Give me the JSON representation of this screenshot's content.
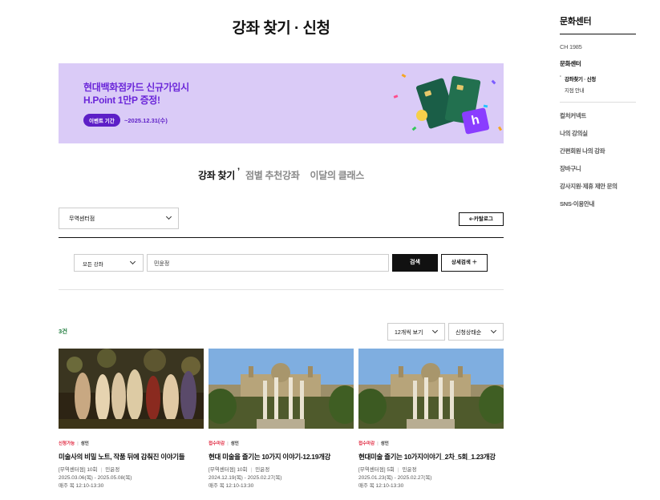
{
  "page": {
    "title": "강좌 찾기 · 신청"
  },
  "sidebar": {
    "title": "문화센터",
    "items": [
      {
        "label": "CH 1985"
      },
      {
        "label": "문화센터"
      }
    ],
    "subs": [
      {
        "label": "강좌찾기 · 신청"
      },
      {
        "label": "지점 안내"
      }
    ],
    "more": [
      {
        "label": "컬처커넥트"
      },
      {
        "label": "나의 강의실"
      },
      {
        "label": "간편회원 나의 강좌"
      },
      {
        "label": "장바구니"
      },
      {
        "label": "강사지원·제휴 제안 문의"
      },
      {
        "label": "SNS·이용안내"
      }
    ]
  },
  "banner": {
    "line1": "현대백화점카드 신규가입시",
    "line2": "H.Point 1만P 증정!",
    "badge": "이벤트 기간",
    "date": "~2025.12.31(수)",
    "colors": {
      "bg": "#dacbf7",
      "accent": "#6b27d9"
    }
  },
  "tabs": [
    {
      "label": "강좌 찾기"
    },
    {
      "label": "점별 추천강좌"
    },
    {
      "label": "이달의 클래스"
    }
  ],
  "filters": {
    "branch": "무역센터점",
    "catalog_label": "e-카탈로그",
    "category": "모든 강좌",
    "search_value": "민윤정",
    "search_label": "검색",
    "detail_label": "상세검색 ＋"
  },
  "results": {
    "count": "3건",
    "per_page": "12개씩 보기",
    "sort": "신청상태순"
  },
  "courses": [
    {
      "status": "신청가능",
      "type": "성인",
      "title": "미술사의 비밀 노트, 작품 뒤에 감춰진 이야기들",
      "info1_branch": "[무역센터점] 10회",
      "info1_teacher": "민윤정",
      "info2": "2025.03.06(목) - 2025.05.08(목)",
      "info3": "매주 목 12:10-13:30"
    },
    {
      "status": "접수마감",
      "type": "성인",
      "title": "현대 미술을 즐기는 10가지 이야기-12.19개강",
      "info1_branch": "[무역센터점] 10회",
      "info1_teacher": "민윤정",
      "info2": "2024.12.19(목) - 2025.02.27(목)",
      "info3": "매주 목 12:10-13:30"
    },
    {
      "status": "접수마감",
      "type": "성인",
      "title": "현대미술 즐기는 10가지이야기_2차_5회_1.23개강",
      "info1_branch": "[무역센터점] 5회",
      "info1_teacher": "민윤정",
      "info2": "2025.01.23(목) - 2025.02.27(목)",
      "info3": "매주 목 12:10-13:30"
    }
  ]
}
